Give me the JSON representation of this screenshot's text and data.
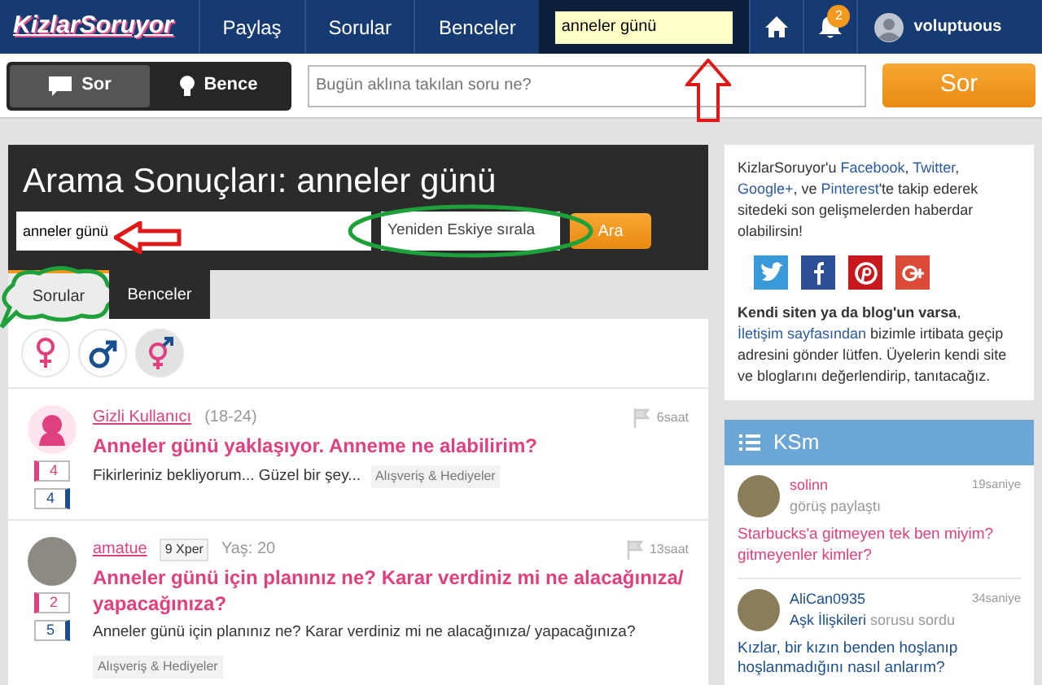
{
  "navbar": {
    "logo": "KizlarSoruyor",
    "links": [
      {
        "label": "Paylaş"
      },
      {
        "label": "Sorular"
      },
      {
        "label": "Benceler"
      }
    ],
    "search": {
      "value": "anneler günü",
      "annotation": {
        "kind": "arrow-up"
      }
    },
    "notifications": "2",
    "username": "voluptuous"
  },
  "ask_bar": {
    "modes": [
      {
        "label": "Sor",
        "kind": "speech",
        "selected": true
      },
      {
        "label": "Bence",
        "kind": "bulb",
        "selected": false
      }
    ],
    "placeholder": "Bugün aklına takılan soru ne?",
    "button": "Sor"
  },
  "search": {
    "title": "Arama Sonuçları: anneler günü",
    "query": "anneler günü",
    "query_annotation": {
      "kind": "arrow-left"
    },
    "sort": "Yeniden Eskiye sırala",
    "sort_annotation": {
      "kind": "ellipse"
    },
    "button": "Ara"
  },
  "tabs": [
    {
      "label": "Sorular",
      "selected": true,
      "annotation": {
        "kind": "cloud"
      }
    },
    {
      "label": "Benceler",
      "selected": false
    }
  ],
  "gender_filters": [
    {
      "kind": "female",
      "selected": false
    },
    {
      "kind": "male",
      "selected": false
    },
    {
      "kind": "both",
      "selected": true
    }
  ],
  "questions": [
    {
      "kind": "anonymous",
      "user": "Gizli Kullanıcı",
      "age": "(18-24)",
      "time": "6saat",
      "title": "Anneler günü yaklaşıyor. Anneme ne alabilirim?",
      "excerpt": "Fikirleriniz bekliyorum... Güzel bir şey...",
      "category": "Alışveriş & Hediyeler",
      "votes_a": "4",
      "votes_b": "4"
    },
    {
      "kind": "member",
      "user": "amatue",
      "xper": "9",
      "xper_label": "Xper",
      "age": "Yaş: 20",
      "time": "13saat",
      "title": "Anneler günü için planınız ne? Karar verdiniz mi ne alacağınıza/ yapacağınıza?",
      "excerpt": "Anneler günü için planınız ne? Karar verdiniz mi ne alacağınıza/ yapacağınıza?",
      "category": "Alışveriş & Hediyeler",
      "votes_a": "2",
      "votes_b": "5"
    }
  ],
  "sidebar": {
    "follow_text": [
      {
        "kind": "text",
        "text": "KizlarSoruyor'u "
      },
      {
        "kind": "link",
        "text": "Facebook"
      },
      {
        "kind": "text",
        "text": ", "
      },
      {
        "kind": "link",
        "text": "Twitter"
      },
      {
        "kind": "text",
        "text": ", "
      },
      {
        "kind": "link",
        "text": "Google+"
      },
      {
        "kind": "text",
        "text": ", ve "
      },
      {
        "kind": "link",
        "text": "Pinterest"
      },
      {
        "kind": "text",
        "text": "'te takip ederek sitedeki son gelişmelerden haberdar olabilirsin!"
      }
    ],
    "social": [
      {
        "kind": "twitter",
        "color": "#3a9ad9"
      },
      {
        "kind": "facebook",
        "color": "#2d4f96"
      },
      {
        "kind": "pinterest",
        "color": "#c8181e"
      },
      {
        "kind": "googleplus",
        "color": "#dc4a38"
      }
    ],
    "blog_text": [
      {
        "kind": "bold",
        "text": "Kendi siten ya da blog'un varsa"
      },
      {
        "kind": "text",
        "text": ", "
      },
      {
        "kind": "link",
        "text": "İletişim sayfasından"
      },
      {
        "kind": "text",
        "text": " bizimle irtibata geçip adresini gönder lütfen. Üyelerin kendi site ve bloglarını değerlendirip, tanıtacağız."
      }
    ]
  },
  "ksm": {
    "title": "KSm",
    "items": [
      {
        "user": "solinn",
        "color": "#e0407f",
        "action": "görüş paylaştı",
        "time": "19saniye",
        "text": "Starbucks'a gitmeyen tek ben miyim? gitmeyenler kimler?"
      },
      {
        "user": "AliCan0935",
        "color": "#1a4f8f",
        "category": "Aşk İlişkileri",
        "action": "sorusu sordu",
        "time": "34saniye",
        "text": "Kızlar, bir kızın benden hoşlanıp hoşlanmadığını nasıl anlarım?"
      }
    ]
  }
}
